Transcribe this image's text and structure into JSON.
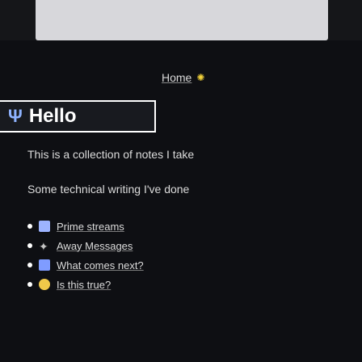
{
  "home": {
    "label": "Home",
    "gear_symbol": "✺"
  },
  "header": {
    "icon": "Ψ",
    "title": "Hello"
  },
  "intro": "This is a collection of notes I take",
  "subtitle": "Some technical writing I've done",
  "links": [
    {
      "icon": "book-icon",
      "label": "Prime streams"
    },
    {
      "icon": "spark-icon",
      "label": "Away Messages"
    },
    {
      "icon": "monitor-icon",
      "label": "What comes next?"
    },
    {
      "icon": "dot-icon",
      "label": "Is this true?"
    }
  ]
}
